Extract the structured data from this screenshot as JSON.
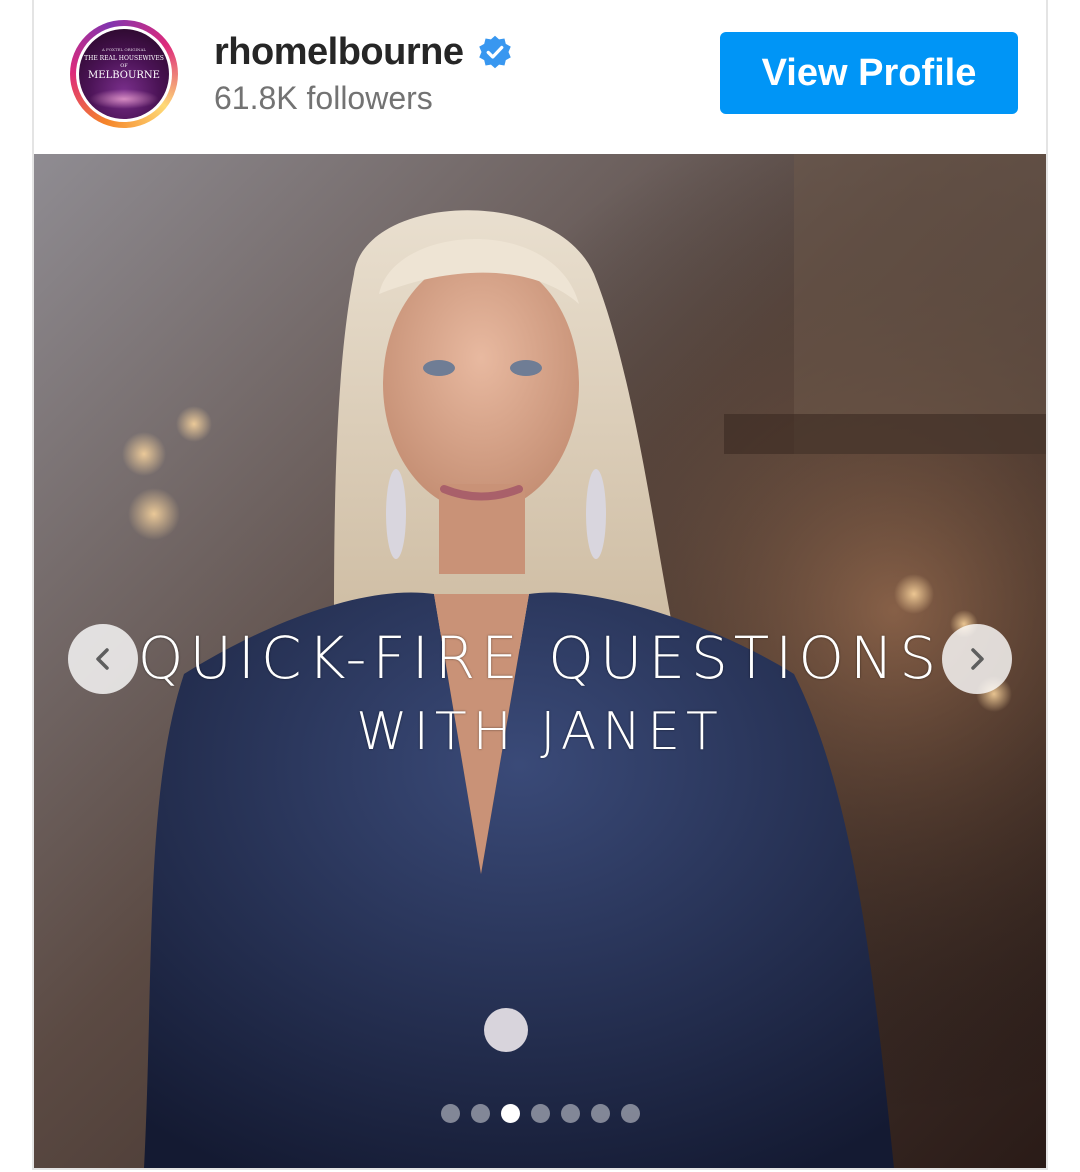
{
  "profile": {
    "username": "rhomelbourne",
    "followers": "61.8K followers",
    "verified_icon": "verified-badge-icon",
    "avatar": {
      "line1": "A FOXTEL ORIGINAL",
      "line2": "THE REAL HOUSEWIVES",
      "line3": "OF",
      "line4": "MELBOURNE"
    },
    "view_profile_label": "View Profile"
  },
  "post": {
    "overlay_line1": "Quick-Fire Questions",
    "overlay_line2": "With Janet",
    "prev_icon": "chevron-left-icon",
    "next_icon": "chevron-right-icon",
    "carousel": {
      "total": 7,
      "active_index": 2
    }
  },
  "colors": {
    "accent": "#0095f6",
    "username": "#262626",
    "secondary_text": "#737373",
    "verified": "#3897f0"
  }
}
